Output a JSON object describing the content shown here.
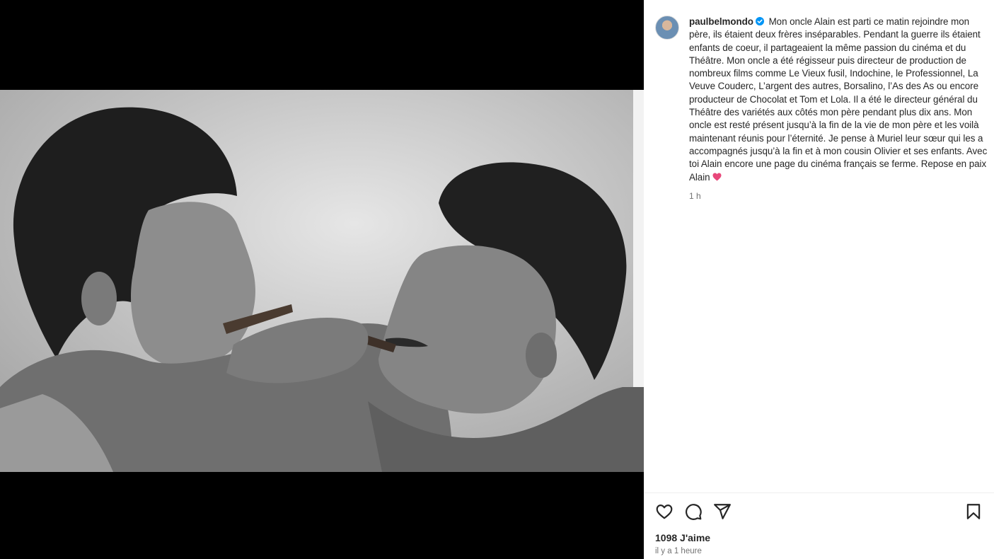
{
  "post": {
    "username": "paulbelmondo",
    "caption": "Mon oncle Alain est parti ce matin rejoindre mon père, ils étaient deux frères inséparables. Pendant la guerre ils étaient enfants de coeur, il partageaient la même passion du cinéma et du Théâtre. Mon oncle a été régisseur puis directeur de production de nombreux films comme Le Vieux fusil, Indochine, le Professionnel, La Veuve Couderc, L’argent des autres, Borsalino, l’As des As ou encore producteur de Chocolat et Tom et Lola. Il a été le directeur général du Théâtre des variétés aux côtés mon père pendant plus dix ans. Mon oncle est resté présent jusqu’à la fin de la vie de mon père et les voilà maintenant réunis pour l’éternité. Je pense à Muriel leur sœur qui les a accompagnés jusqu’à la fin et à mon cousin Olivier et ses enfants. Avec toi Alain encore une page du cinéma français se ferme. Repose en paix Alain",
    "caption_time": "1 h",
    "likes": "1098 J'aime",
    "posted_ago": "il y a 1 heure"
  },
  "icons": {
    "verified": "verified-badge-icon",
    "heart_emoji": "pink-heart-emoji",
    "like": "heart-outline-icon",
    "comment": "comment-bubble-icon",
    "share": "paper-plane-icon",
    "save": "bookmark-icon"
  },
  "colors": {
    "verified": "#0095f6",
    "heart_emoji": "#e8477a",
    "text": "#262626",
    "secondary": "#737373"
  }
}
